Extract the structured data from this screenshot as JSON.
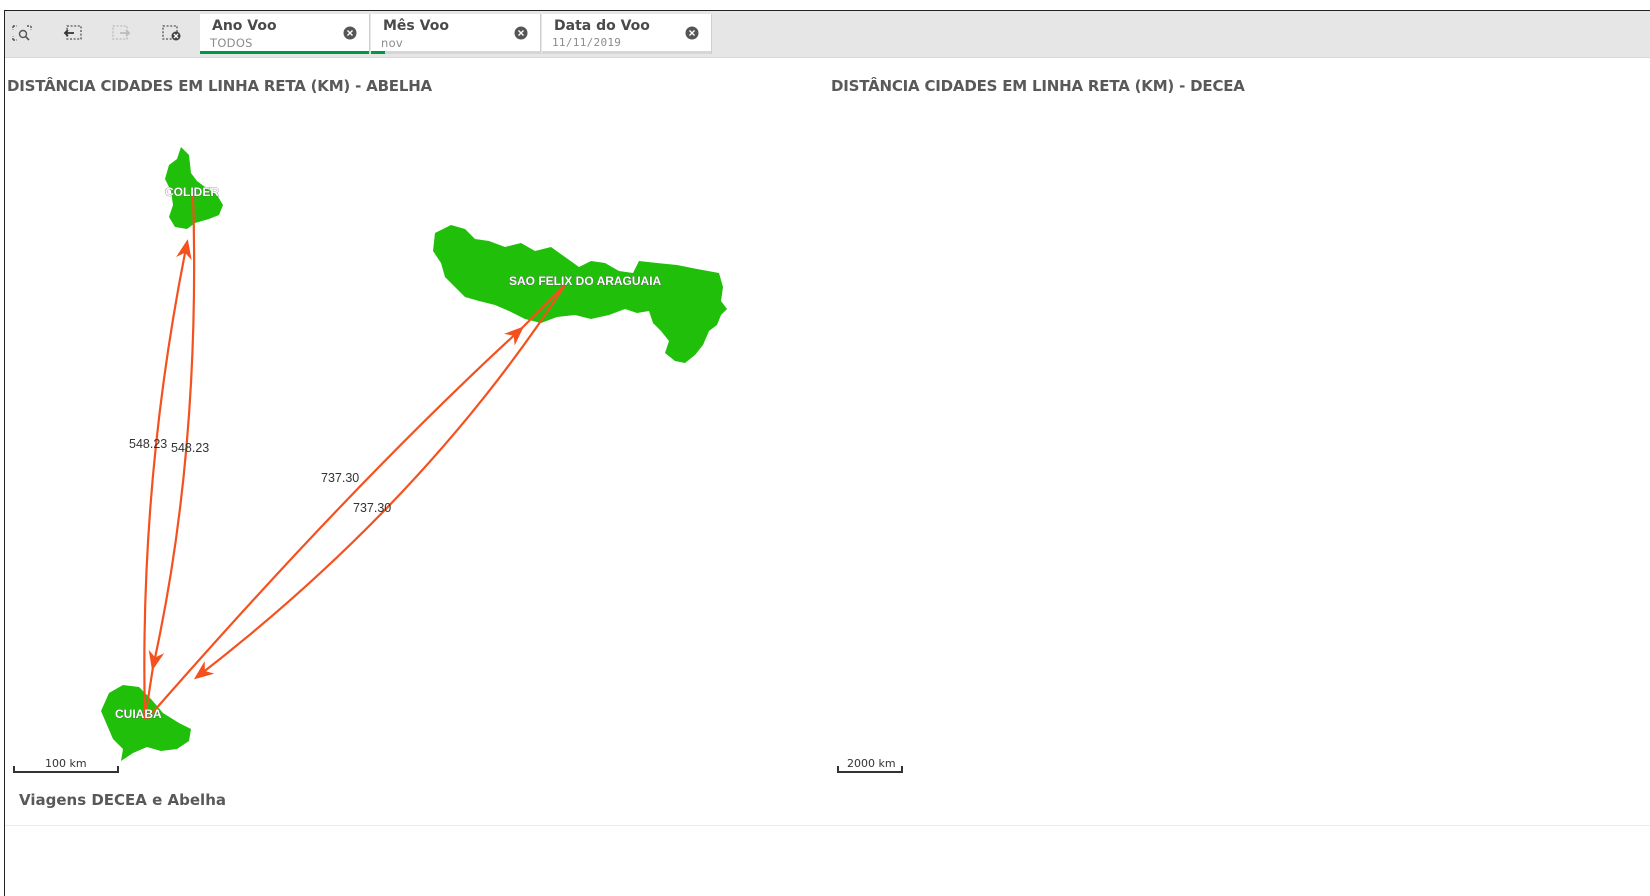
{
  "toolbar": {
    "tools": [
      {
        "name": "smart-search-icon"
      },
      {
        "name": "step-back-icon"
      },
      {
        "name": "step-forward-icon"
      },
      {
        "name": "clear-selections-icon"
      }
    ],
    "filters": [
      {
        "title": "Ano Voo",
        "value": "TODOS",
        "fill": 1.0
      },
      {
        "title": "Mês Voo",
        "value": "nov",
        "fill": 0.08
      },
      {
        "title": "Data do Voo",
        "value": "11/11/2019",
        "fill": 0.0
      }
    ]
  },
  "panels": {
    "abelha": {
      "title": "DISTÂNCIA CIDADES EM LINHA RETA (KM) - ABELHA",
      "scale_label": "100 km",
      "cities": [
        "COLIDER",
        "SAO FELIX DO ARAGUAIA",
        "CUIABA"
      ],
      "routes": [
        {
          "label": "548.23"
        },
        {
          "label": "548.23"
        },
        {
          "label": "737.30"
        },
        {
          "label": "737.30"
        }
      ]
    },
    "decea": {
      "title": "DISTÂNCIA CIDADES EM LINHA RETA (KM) - DECEA",
      "scale_label": "2000 km"
    }
  },
  "bottom": {
    "title": "Viagens DECEA e Abelha"
  },
  "colors": {
    "region_fill": "#1fbf0a",
    "route": "#f4511e",
    "selection_green": "#009845",
    "toolbar_bg": "#e6e6e6"
  }
}
